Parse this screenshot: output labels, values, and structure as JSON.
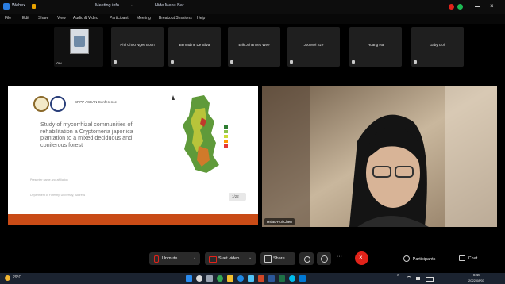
{
  "window": {
    "title": "Webex",
    "meeting_info": "Meeting info",
    "right_label": "Hide Menu Bar"
  },
  "menu": [
    "File",
    "Edit",
    "Share",
    "View",
    "Audio & Video",
    "Participant",
    "Meeting",
    "Breakout Sessions",
    "Help"
  ],
  "gallery": {
    "self_label": "You",
    "tiles": [
      "Phil Choo Ngee Boon",
      "Bernadine De Silva",
      "Erik Johannes Wee",
      "Joo Mei Sze",
      "Hoang Ha",
      "Gaby Goh"
    ]
  },
  "slide": {
    "header_label": "SRPP ASEAN Conference",
    "title": "Study of mycorrhizal communities of rehabilitation a Cryptomeria japonica plantation to a mixed deciduous and coniferous forest",
    "author_line": "Presenter name and affiliation",
    "affiliations_line": "Department of Forestry, University, Address",
    "page_num": "1/22"
  },
  "video": {
    "name_label": "Hsiao-Hui Chen"
  },
  "toolbar": {
    "unmute": "Unmute",
    "start_video": "Start video",
    "share": "Share",
    "participants": "Participants",
    "chat": "Chat"
  },
  "taskbar": {
    "weather": "29°C",
    "time": "8:46",
    "date": "2022/08/03"
  },
  "colors": {
    "accent_red": "#e2231a",
    "slide_footer": "#c94b16",
    "taskbar": "#1b2330"
  }
}
